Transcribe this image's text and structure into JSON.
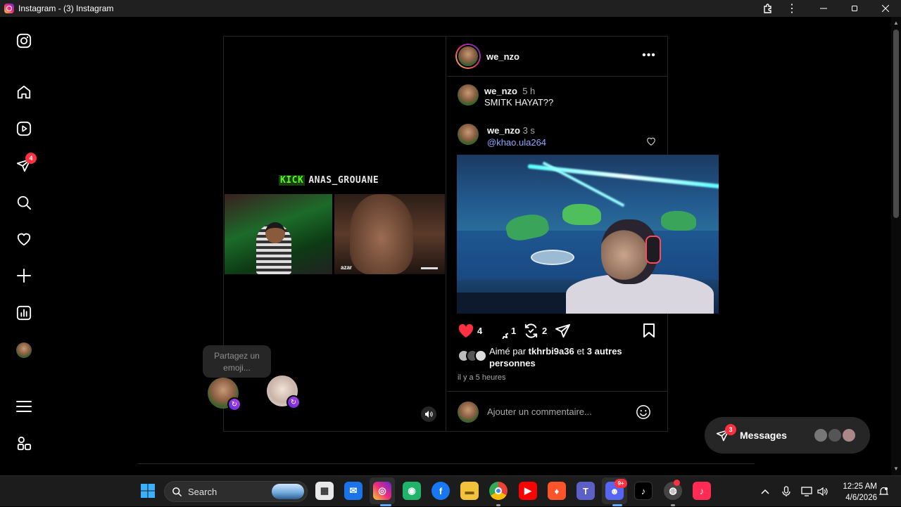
{
  "window": {
    "title": "Instagram - (3) Instagram"
  },
  "sidebar": {
    "notifications_badge": "4",
    "items": [
      "instagram-logo",
      "home",
      "reels",
      "direct",
      "search",
      "notifications",
      "create",
      "dashboard",
      "profile",
      "more",
      "also-from-meta"
    ]
  },
  "post": {
    "username": "we_nzo",
    "media": {
      "overlay_brand": "KICK",
      "overlay_channel": "ANAS_GROUANE",
      "right_tile_brand": "azar"
    },
    "caption": {
      "username": "we_nzo",
      "time": "5 h",
      "text": "SMITK HAYAT??"
    },
    "comment": {
      "username": "we_nzo",
      "time": "3 s",
      "mention": "@khao.ula264"
    },
    "actions": {
      "likes": "4",
      "comments": "1",
      "reposts": "2"
    },
    "liked_by": {
      "prefix": "Aimé par",
      "user": "tkhrbi9a36",
      "middle": "et",
      "others": "3 autres personnes"
    },
    "timestamp": "il y a 5 heures",
    "add_comment_placeholder": "Ajouter un commentaire..."
  },
  "share_tooltip": "Partagez un emoji...",
  "messages": {
    "label": "Messages",
    "badge": "3"
  },
  "taskbar": {
    "search_label": "Search",
    "discord_badge": "9+",
    "clock_time": "12:25 AM",
    "clock_date": "4/6/2026"
  },
  "colors": {
    "accent_red": "#ff3040",
    "mention_blue": "#8ea8ff",
    "background": "#000000",
    "border": "#262626"
  }
}
